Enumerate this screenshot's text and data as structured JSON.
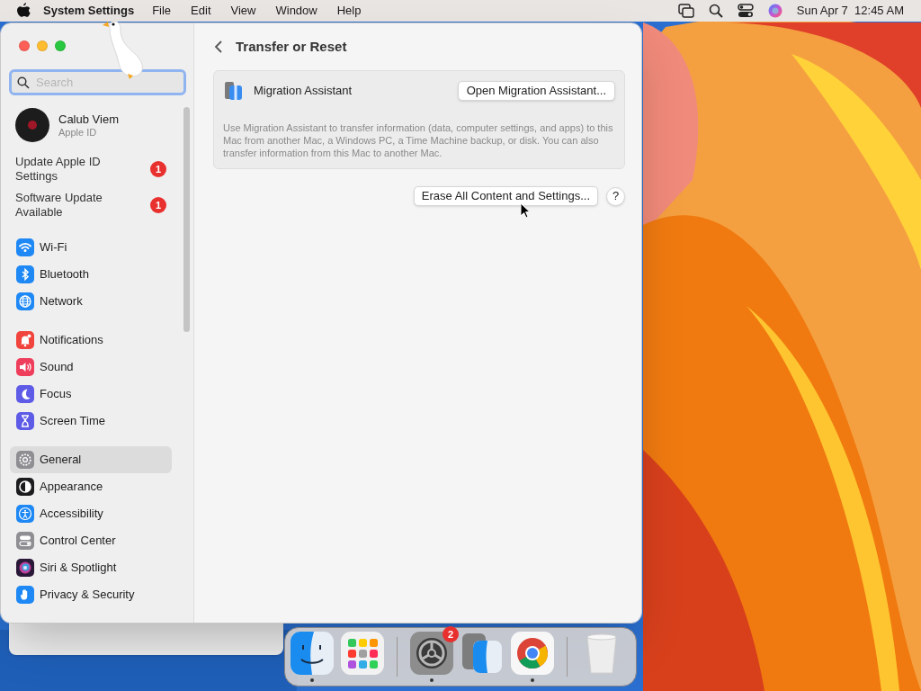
{
  "menu_bar": {
    "app_name": "System Settings",
    "menus": [
      "File",
      "Edit",
      "View",
      "Window",
      "Help"
    ],
    "clock": "Sun Apr 7  12:45 AM"
  },
  "sidebar": {
    "search": {
      "placeholder": "Search"
    },
    "account": {
      "name": "Calub Viem",
      "subtitle": "Apple ID"
    },
    "notices": [
      {
        "label": "Update Apple ID Settings",
        "badge": "1"
      },
      {
        "label": "Software Update Available",
        "badge": "1"
      }
    ],
    "groups": [
      [
        {
          "label": "Wi-Fi",
          "selected": false
        },
        {
          "label": "Bluetooth",
          "selected": false
        },
        {
          "label": "Network",
          "selected": false
        }
      ],
      [
        {
          "label": "Notifications",
          "selected": false
        },
        {
          "label": "Sound",
          "selected": false
        },
        {
          "label": "Focus",
          "selected": false
        },
        {
          "label": "Screen Time",
          "selected": false
        }
      ],
      [
        {
          "label": "General",
          "selected": true
        },
        {
          "label": "Appearance",
          "selected": false
        },
        {
          "label": "Accessibility",
          "selected": false
        },
        {
          "label": "Control Center",
          "selected": false
        },
        {
          "label": "Siri & Spotlight",
          "selected": false
        },
        {
          "label": "Privacy & Security",
          "selected": false
        }
      ]
    ]
  },
  "main": {
    "title": "Transfer or Reset",
    "migration": {
      "title": "Migration Assistant",
      "button": "Open Migration Assistant...",
      "description": "Use Migration Assistant to transfer information (data, computer settings, and apps) to this Mac from another Mac, a Windows PC, a Time Machine backup, or disk. You can also transfer information from this Mac to another Mac."
    },
    "erase_button": "Erase All Content and Settings...",
    "help_button": "?"
  },
  "dock": {
    "groups": [
      [
        {
          "kind": "finder",
          "running": true
        },
        {
          "kind": "launchpad",
          "running": false
        }
      ],
      [
        {
          "kind": "settings",
          "running": true,
          "badge": "2"
        },
        {
          "kind": "migration",
          "running": false
        },
        {
          "kind": "chrome",
          "running": true
        }
      ],
      [
        {
          "kind": "trash",
          "running": false
        }
      ]
    ]
  }
}
